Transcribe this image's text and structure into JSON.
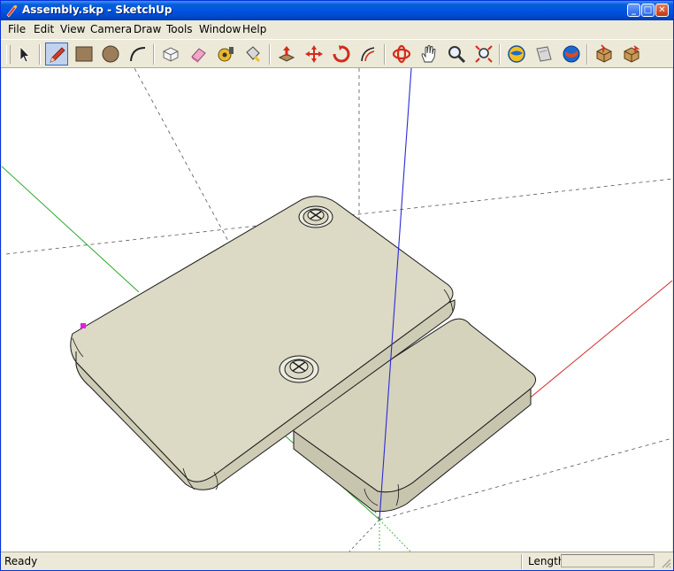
{
  "window": {
    "title": "Assembly.skp - SketchUp"
  },
  "title_buttons": {
    "minimize": "_",
    "maximize": "□",
    "close": "✕"
  },
  "menu": [
    "File",
    "Edit",
    "View",
    "Camera",
    "Draw",
    "Tools",
    "Window",
    "Help"
  ],
  "toolbar": {
    "tools": [
      {
        "name": "select-tool",
        "icon": "arrow-pointer-icon",
        "active": false
      },
      {
        "name": "line-tool",
        "icon": "pencil-icon",
        "active": true
      },
      {
        "name": "rectangle-tool",
        "icon": "rectangle-icon",
        "active": false
      },
      {
        "name": "circle-tool",
        "icon": "circle-icon",
        "active": false
      },
      {
        "name": "arc-tool",
        "icon": "arc-icon",
        "active": false
      },
      {
        "name": "make-component-tool",
        "icon": "component-icon",
        "active": false
      },
      {
        "name": "eraser-tool",
        "icon": "eraser-icon",
        "active": false
      },
      {
        "name": "tape-measure-tool",
        "icon": "tape-measure-icon",
        "active": false
      },
      {
        "name": "paint-bucket-tool",
        "icon": "paint-bucket-icon",
        "active": false
      },
      {
        "name": "push-pull-tool",
        "icon": "push-pull-icon",
        "active": false
      },
      {
        "name": "move-tool",
        "icon": "move-icon",
        "active": false
      },
      {
        "name": "rotate-tool",
        "icon": "rotate-icon",
        "active": false
      },
      {
        "name": "offset-tool",
        "icon": "offset-icon",
        "active": false
      },
      {
        "name": "orbit-tool",
        "icon": "orbit-icon",
        "active": false
      },
      {
        "name": "pan-tool",
        "icon": "hand-icon",
        "active": false
      },
      {
        "name": "zoom-tool",
        "icon": "magnifier-icon",
        "active": false
      },
      {
        "name": "zoom-extents-tool",
        "icon": "zoom-extents-icon",
        "active": false
      },
      {
        "name": "get-models-tool",
        "icon": "globe-icon",
        "active": false
      },
      {
        "name": "share-model-tool",
        "icon": "share-icon",
        "active": false
      },
      {
        "name": "google-earth-tool",
        "icon": "earth-icon",
        "active": false
      },
      {
        "name": "get-components-tool",
        "icon": "box-icon",
        "active": false
      },
      {
        "name": "share-component-tool",
        "icon": "box-share-icon",
        "active": false
      }
    ]
  },
  "status": {
    "text": "Ready",
    "length_label": "Length",
    "length_value": ""
  },
  "colors": {
    "plate": "#dcd9c4",
    "plate_side": "#c9c6b0",
    "edge": "#1a1a1a",
    "axis_red": "#d42a2a",
    "axis_green": "#2ba82b",
    "axis_blue": "#2b2bd6"
  }
}
